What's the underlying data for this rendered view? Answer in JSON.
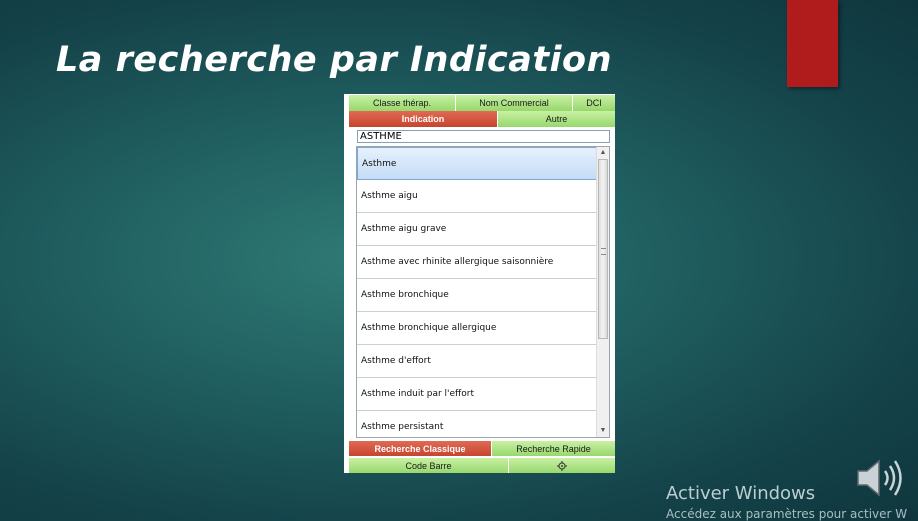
{
  "slide": {
    "title": "La recherche par Indication"
  },
  "tabs_top": [
    "Classe thérap.",
    "Nom Commercial",
    "DCI"
  ],
  "tabs_second": {
    "active": "Indication",
    "other": "Autre"
  },
  "search": {
    "value": "ASTHME"
  },
  "results": [
    "Asthme",
    "Asthme aigu",
    "Asthme aigu grave",
    "Asthme avec rhinite allergique saisonnière",
    "Asthme bronchique",
    "Asthme bronchique allergique",
    "Asthme d'effort",
    "Asthme induit par l'effort",
    "Asthme persistant"
  ],
  "bottom_tabs": {
    "active": "Recherche Classique",
    "other": "Recherche Rapide",
    "barcode": "Code Barre"
  },
  "windows_watermark": {
    "title": "Activer Windows",
    "subtitle": "Accédez aux paramètres pour activer W"
  },
  "colors": {
    "accent_red": "#b01c1c",
    "tab_green": "#a8e07c",
    "tab_active": "#d4563f",
    "selected_row": "#cfe2f9"
  },
  "icons": [
    "speaker-icon",
    "settings-icon"
  ]
}
